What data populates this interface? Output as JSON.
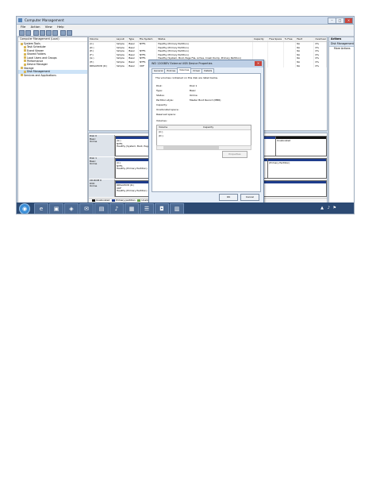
{
  "window": {
    "title": "Computer Management"
  },
  "menubar": {
    "items": [
      "File",
      "Action",
      "View",
      "Help"
    ]
  },
  "tree": {
    "header": "Computer Management (Local)",
    "nodes": [
      "System Tools",
      "Task Scheduler",
      "Event Viewer",
      "Shared Folders",
      "Local Users and Groups",
      "Performance",
      "Device Manager",
      "Storage",
      "Disk Management",
      "Services and Applications"
    ]
  },
  "volumes": {
    "headers": [
      "Volume",
      "Layout",
      "Type",
      "File System",
      "Status",
      "Capacity",
      "Free Space",
      "% Free",
      "Fault Tolerance",
      "Overhead"
    ],
    "rows": [
      [
        "(C:)",
        "Simple",
        "Basic",
        "NTFS",
        "Healthy (Primary Partition)",
        "",
        "",
        "",
        "No",
        "0%"
      ],
      [
        "(D:)",
        "Simple",
        "Basic",
        "",
        "Healthy (Primary Partition)",
        "",
        "",
        "",
        "No",
        "0%"
      ],
      [
        "(E:)",
        "Simple",
        "Basic",
        "NTFS",
        "Healthy (Primary Partition)",
        "",
        "",
        "",
        "No",
        "0%"
      ],
      [
        "(F:)",
        "Simple",
        "Basic",
        "NTFS",
        "Healthy (Primary Partition)",
        "",
        "",
        "",
        "No",
        "0%"
      ],
      [
        "(G:)",
        "Simple",
        "Basic",
        "NTFS",
        "Healthy (System, Boot, Page File, Active, Crash Dump, Primary Partition)",
        "",
        "",
        "",
        "No",
        "0%"
      ],
      [
        "(H:)",
        "Simple",
        "Basic",
        "NTFS",
        "Healthy (Primary Partition)",
        "",
        "",
        "",
        "No",
        "0%"
      ],
      [
        "RRSAVDVD (R:)",
        "Simple",
        "Basic",
        "UDF",
        "Healthy (Primary Partition)",
        "",
        "",
        "",
        "No",
        "0%"
      ]
    ]
  },
  "disks": [
    {
      "name": "Disk 0",
      "type": "Basic",
      "status": "Online",
      "volumes": [
        {
          "label": "(G:)",
          "fs": "NTFS",
          "status": "Healthy (System, Boot, Page F...)"
        },
        {
          "label": "",
          "fs": "",
          "status": ""
        },
        {
          "label": "",
          "fs": "",
          "status": "Unallocated"
        }
      ]
    },
    {
      "name": "Disk 1",
      "type": "Basic",
      "status": "Online",
      "volumes": [
        {
          "label": "(C:)",
          "fs": "NTFS",
          "status": "Healthy (Primary Partition)"
        },
        {
          "label": "",
          "fs": "",
          "status": "(Primary Partition)"
        }
      ]
    },
    {
      "name": "CD-ROM 0",
      "type": "DVD",
      "status": "Online",
      "volumes": [
        {
          "label": "RRSAVDVD (R:)",
          "fs": "UDF",
          "status": "Healthy (Primary Partition)"
        }
      ]
    }
  ],
  "legend": [
    "Unallocated",
    "Primary partition",
    "Unallocated space"
  ],
  "actions": {
    "header": "Actions",
    "section": "Disk Management",
    "more": "More Actions"
  },
  "dialog": {
    "title": "WD 1200BEV External USB Device Properties",
    "tabs": [
      "General",
      "Policies",
      "Volumes",
      "Driver",
      "Details"
    ],
    "active_tab": "Volumes",
    "description": "The volumes contained on this disk are listed below.",
    "fields": [
      {
        "k": "Disk:",
        "v": "Disk 1"
      },
      {
        "k": "Type:",
        "v": "Basic"
      },
      {
        "k": "Status:",
        "v": "Online"
      },
      {
        "k": "Partition style:",
        "v": "Master Boot Record (MBR)"
      },
      {
        "k": "Capacity:",
        "v": ""
      },
      {
        "k": "Unallocated space:",
        "v": ""
      },
      {
        "k": "Reserved space:",
        "v": ""
      }
    ],
    "volumes_label": "Volumes:",
    "vol_headers": [
      "Volume",
      "Capacity"
    ],
    "vol_rows": [
      [
        "(C:)",
        ""
      ],
      [
        "(D:)",
        ""
      ]
    ],
    "properties_button": "Properties",
    "ok": "OK",
    "cancel": "Cancel"
  },
  "taskbar": {
    "start_glyph": "◉",
    "icons": [
      "e",
      "▣",
      "◈",
      "✉",
      "▤",
      "♪",
      "▦",
      "☰",
      "◘",
      "▥"
    ]
  }
}
